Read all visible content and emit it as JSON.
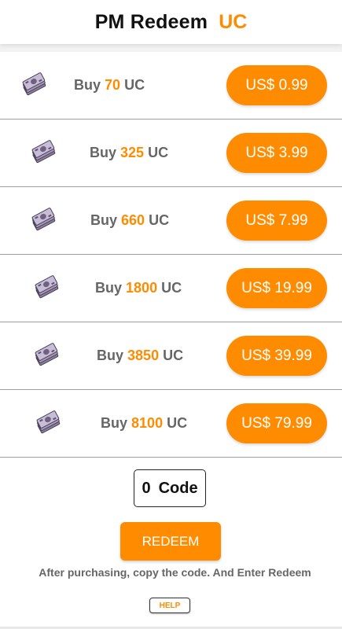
{
  "header": {
    "title": "PM Redeem",
    "accent": "UC"
  },
  "colors": {
    "accent": "#ff8c00",
    "label_gray": "#666666",
    "divider": "#9e9e9e"
  },
  "packages": [
    {
      "prefix": "Buy",
      "amount": "70",
      "unit": "UC",
      "price": "US$ 0.99",
      "icon": "money-stack-icon"
    },
    {
      "prefix": "Buy",
      "amount": "325",
      "unit": "UC",
      "price": "US$ 3.99",
      "icon": "money-stack-icon"
    },
    {
      "prefix": "Buy",
      "amount": "660",
      "unit": "UC",
      "price": "US$ 7.99",
      "icon": "money-stack-icon"
    },
    {
      "prefix": "Buy",
      "amount": "1800",
      "unit": "UC",
      "price": "US$ 19.99",
      "icon": "money-stack-icon"
    },
    {
      "prefix": "Buy",
      "amount": "3850",
      "unit": "UC",
      "price": "US$ 39.99",
      "icon": "money-stack-icon"
    },
    {
      "prefix": "Buy",
      "amount": "8100",
      "unit": "UC",
      "price": "US$ 79.99",
      "icon": "money-stack-icon"
    }
  ],
  "code": {
    "count": "0",
    "label": "Code"
  },
  "redeem_label": "REDEEM",
  "hint": "After purchasing, copy the code. And Enter Redeem",
  "help_label": "HELP"
}
